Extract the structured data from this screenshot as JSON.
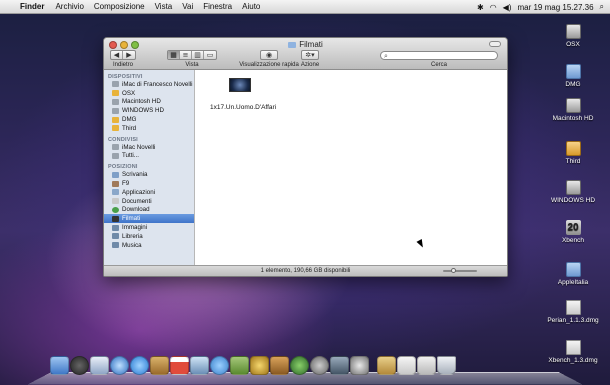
{
  "menubar": {
    "apple": "",
    "app": "Finder",
    "items": [
      "Archivio",
      "Composizione",
      "Vista",
      "Vai",
      "Finestra",
      "Aiuto"
    ],
    "clock": "mar 19 mag  15.27.36"
  },
  "window": {
    "title": "Filmati",
    "toolbar": {
      "back_label": "Indietro",
      "view_label": "Vista",
      "quicklook_label": "Visualizzazione rapida",
      "action_label": "Azione",
      "search_label": "Cerca",
      "search_placeholder": ""
    },
    "sidebar": {
      "sections": [
        {
          "title": "DISPOSITIVI",
          "items": [
            "iMac di Francesco Novelli",
            "OSX",
            "Macintosh HD",
            "WINDOWS HD",
            "DMG",
            "Third"
          ]
        },
        {
          "title": "CONDIVISI",
          "items": [
            "iMac Novelli",
            "Tutti..."
          ]
        },
        {
          "title": "POSIZIONI",
          "items": [
            "Scrivania",
            "F9",
            "Applicazioni",
            "Documenti",
            "Download",
            "Filmati",
            "Immagini",
            "Libreria",
            "Musica"
          ]
        }
      ],
      "selected": "Filmati"
    },
    "files": [
      {
        "name": "1x17.Un.Uomo.D'Affari"
      }
    ],
    "status": "1 elemento, 190,66 GB disponibili"
  },
  "desktop": [
    {
      "label": "OSX",
      "icon": "disk-icon"
    },
    {
      "label": "DMG",
      "icon": "folder-icon"
    },
    {
      "label": "Macintosh HD",
      "icon": "disk-icon"
    },
    {
      "label": "Third",
      "icon": "folder-icon"
    },
    {
      "label": "WINDOWS HD",
      "icon": "disk-icon"
    },
    {
      "label": "Xbench",
      "icon": "xbench-icon"
    },
    {
      "label": "AppleItalia",
      "icon": "folder-icon"
    },
    {
      "label": "Perian_1.1.3.dmg",
      "icon": "dmg-icon"
    },
    {
      "label": "Xbench_1.3.dmg",
      "icon": "dmg-icon"
    }
  ],
  "dock": {
    "icons": [
      "finder-icon",
      "dashboard-icon",
      "mail-icon",
      "safari-icon",
      "ichat-icon",
      "addressbook-icon",
      "ical-icon",
      "preview-icon",
      "itunes-icon",
      "iphoto-icon",
      "imovie-icon",
      "garageband-icon",
      "timemachine-icon",
      "systempreferences-icon",
      "spaces-icon",
      "photobooth-icon",
      "applications-folder-icon",
      "documents-folder-icon",
      "downloads-stack-icon",
      "trash-icon"
    ]
  }
}
